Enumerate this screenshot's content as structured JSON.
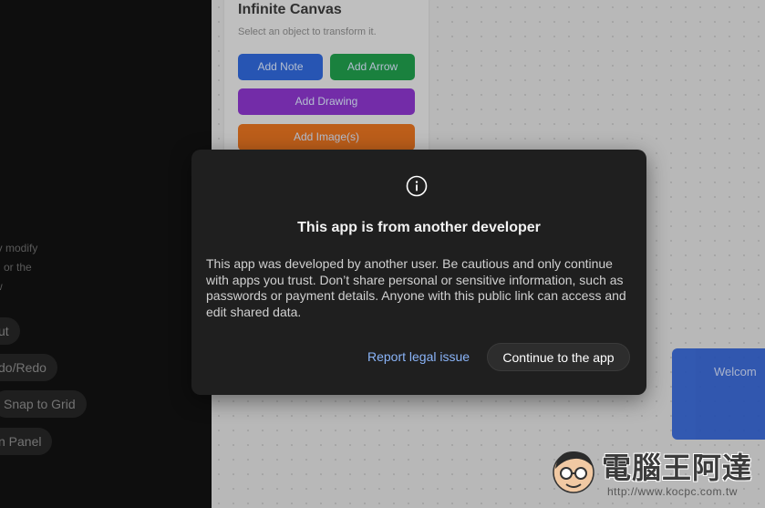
{
  "toolbox": {
    "title": "Infinite Canvas",
    "subtitle": "Select an object to transform it.",
    "buttons": [
      {
        "label": "Add Note",
        "color": "#2f66d6"
      },
      {
        "label": "Add Arrow",
        "color": "#1f9a4a"
      },
      {
        "label": "Add Drawing",
        "color": "#8a35c9"
      },
      {
        "label": "Add Image(s)",
        "color": "#e0701f"
      }
    ]
  },
  "left_panel": {
    "description_lines": [
      "ly modify",
      "d or the",
      "w"
    ],
    "chips": [
      "ut",
      "do/Redo",
      "Snap to Grid",
      "n Panel"
    ]
  },
  "canvas": {
    "card_text": "Welcom"
  },
  "modal": {
    "icon": "info-icon",
    "title": "This app is from another developer",
    "body": "This app was developed by another user. Be cautious and only continue with apps you trust. Don’t share personal or sensitive information, such as passwords or payment details. Anyone with this public link can access and edit shared data.",
    "report_label": "Report legal issue",
    "continue_label": "Continue to the app",
    "link_color": "#8ab4f8"
  },
  "watermark": {
    "text": "電腦王阿達",
    "url": "http://www.kocpc.com.tw"
  }
}
